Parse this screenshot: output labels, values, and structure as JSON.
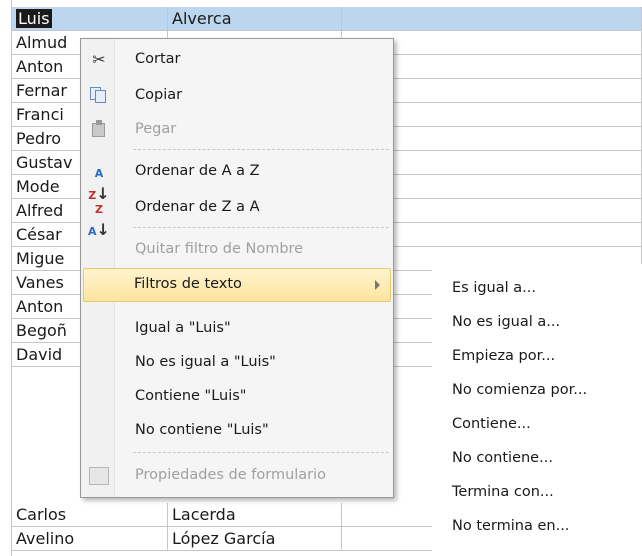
{
  "rows": [
    {
      "name": "Luis",
      "surname": "Alverca",
      "selected": true
    },
    {
      "name": "Almud",
      "surname": ""
    },
    {
      "name": "Anton",
      "surname": ""
    },
    {
      "name": "Fernar",
      "surname": ""
    },
    {
      "name": "Franci",
      "surname": ""
    },
    {
      "name": "Pedro",
      "surname": ""
    },
    {
      "name": "Gustav",
      "surname": ""
    },
    {
      "name": "Mode",
      "surname": ""
    },
    {
      "name": "Alfred",
      "surname": ""
    },
    {
      "name": "César",
      "surname": ""
    },
    {
      "name": "Migue",
      "surname": ""
    },
    {
      "name": "Vanes",
      "surname": ""
    },
    {
      "name": "Anton",
      "surname": ""
    },
    {
      "name": "Begoñ",
      "surname": ""
    },
    {
      "name": "David",
      "surname": ""
    },
    {
      "name": "Carlos",
      "surname": "Lacerda"
    },
    {
      "name": "Avelino",
      "surname": "López García"
    }
  ],
  "menu": {
    "cut": "Cortar",
    "copy": "Copiar",
    "paste": "Pegar",
    "sort_az": "Ordenar de A a Z",
    "sort_za": "Ordenar de Z a A",
    "remove_filter": "Quitar filtro de Nombre",
    "text_filters": "Filtros de texto",
    "equals": "Igual a \"Luis\"",
    "not_equals": "No es igual a \"Luis\"",
    "contains": "Contiene \"Luis\"",
    "not_contains": "No contiene \"Luis\"",
    "form_properties": "Propiedades de formulario"
  },
  "submenu": [
    "Es igual a...",
    "No es igual a...",
    "Empieza por...",
    "No comienza por...",
    "Contiene...",
    "No contiene...",
    "Termina con...",
    "No termina en..."
  ],
  "icons": {
    "cut": "scissors-icon",
    "copy": "copy-icon",
    "paste": "paste-icon",
    "sort_az": "sort-ascending-icon",
    "sort_za": "sort-descending-icon",
    "form_properties": "form-properties-icon",
    "submenu_arrow": "submenu-arrow-icon"
  },
  "colors": {
    "selection": "#bcd6ef",
    "menu_highlight": "#fde49f"
  }
}
